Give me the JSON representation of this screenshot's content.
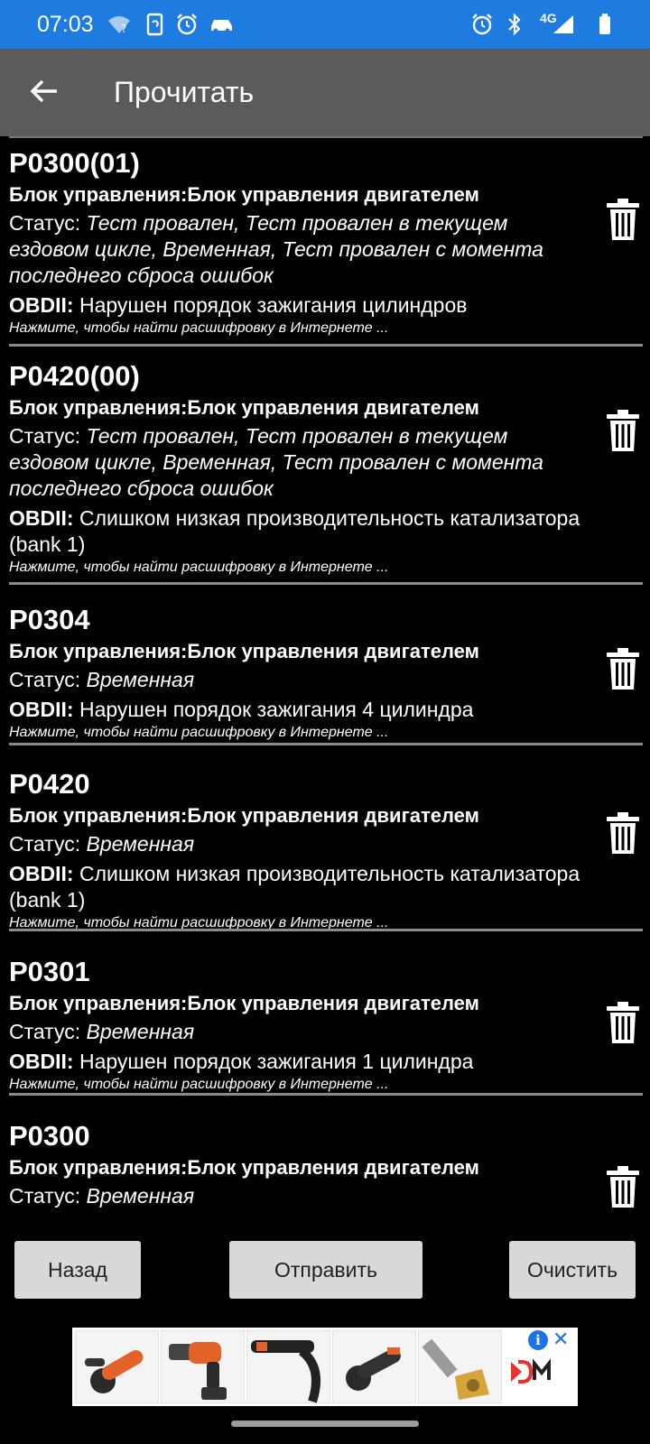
{
  "status_bar": {
    "time": "07:03",
    "network": "4G",
    "color": "#1e7be0",
    "left_icons": [
      "wifi-question-icon",
      "sync-phone-icon",
      "alarm-icon",
      "car-icon"
    ],
    "right_icons": [
      "alarm-icon",
      "bluetooth-icon",
      "signal-icon",
      "battery-icon"
    ]
  },
  "app_bar": {
    "title": "Прочитать",
    "back_icon": "arrow-left-icon",
    "color": "#5b5b5b"
  },
  "dtc_list": [
    {
      "code": "P0300(01)",
      "module": "Блок управления:Блок управления двигателем",
      "status_label": "Статус: ",
      "status_value": "Тест провален, Тест провален в текущем ездовом цикле, Временная, Тест провален с момента последнего сброса ошибок",
      "obd_label": "OBDII:",
      "obd_value": " Нарушен порядок зажигания цилиндров",
      "hint": "Нажмите, чтобы найти расшифровку в Интернете ..."
    },
    {
      "code": "P0420(00)",
      "module": "Блок управления:Блок управления двигателем",
      "status_label": "Статус: ",
      "status_value": "Тест провален, Тест провален в текущем ездовом цикле, Временная, Тест провален с момента последнего сброса ошибок",
      "obd_label": "OBDII:",
      "obd_value": " Слишком низкая производительность катализатора (bank 1)",
      "hint": "Нажмите, чтобы найти расшифровку в Интернете ..."
    },
    {
      "code": "P0304",
      "module": "Блок управления:Блок управления двигателем",
      "status_label": "Статус: ",
      "status_value": "Временная",
      "obd_label": "OBDII:",
      "obd_value": " Нарушен порядок зажигания 4 цилиндра",
      "hint": "Нажмите, чтобы найти расшифровку в Интернете ..."
    },
    {
      "code": "P0420",
      "module": "Блок управления:Блок управления двигателем",
      "status_label": "Статус: ",
      "status_value": "Временная",
      "obd_label": "OBDII:",
      "obd_value": " Слишком низкая производительность катализатора (bank 1)",
      "hint": "Нажмите, чтобы найти расшифровку в Интернете ..."
    },
    {
      "code": "P0301",
      "module": "Блок управления:Блок управления двигателем",
      "status_label": "Статус: ",
      "status_value": "Временная",
      "obd_label": "OBDII:",
      "obd_value": " Нарушен порядок зажигания 1 цилиндра",
      "hint": "Нажмите, чтобы найти расшифровку в Интернете ..."
    },
    {
      "code": "P0300",
      "module": "Блок управления:Блок управления двигателем",
      "status_label": "Статус: ",
      "status_value": "Временная",
      "obd_label": "",
      "obd_value": "",
      "hint": ""
    }
  ],
  "trash_icon": "trash-icon",
  "buttons": {
    "back": "Назад",
    "send": "Отправить",
    "clear": "Очистить"
  },
  "ad": {
    "products": [
      "angle-grinder",
      "drill",
      "electric-screwdriver",
      "angle-grinder",
      "router-bit"
    ],
    "brand_icon": "dm-logo-icon",
    "info_icon": "info-icon",
    "close_icon": "close-icon",
    "info_symbol": "i",
    "close_symbol": "✕",
    "brand_color": "#e8322a"
  }
}
